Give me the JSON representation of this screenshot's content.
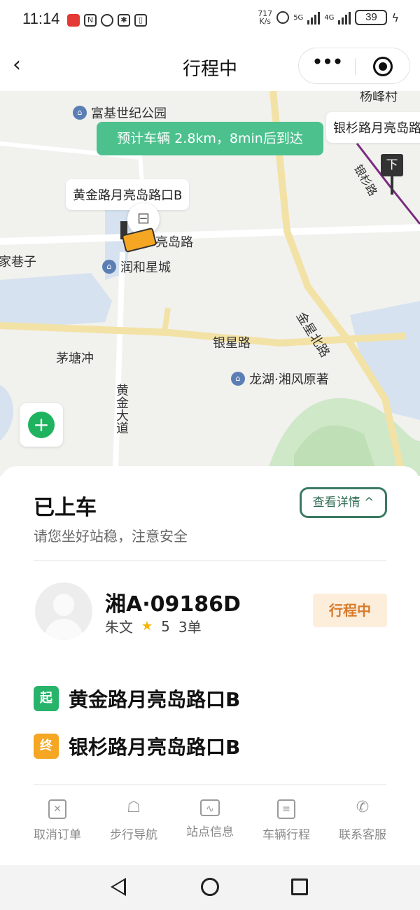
{
  "status_bar": {
    "time": "11:14",
    "net_speed_value": "717",
    "net_speed_unit": "K/s",
    "battery": "39",
    "signal_5g": "5G",
    "signal_4g": "4G"
  },
  "nav": {
    "title": "行程中",
    "back_icon": "chevron-left-icon",
    "more_icon": "more-dots-icon",
    "target_icon": "target-icon"
  },
  "map": {
    "eta_text": "预计车辆 2.8km，8min后到达",
    "pickup_stop": "黄金路月亮岛路口B",
    "dropoff_stop": "银杉路月亮岛路",
    "dropoff_marker": "下",
    "roads": {
      "moon_island_road": "亮岛路",
      "yinxing_road": "银星路",
      "jinxing_north_road": "金星北路",
      "huangjin_avenue": "黄金大道",
      "yinshan_road": "银杉路"
    },
    "places": {
      "fuji_park": "富基世纪公园",
      "runhe_city": "润和星城",
      "longhu": "龙湖·湘风原著",
      "maotangchong": "茅塘冲",
      "jia_alley": "家巷子",
      "yangfeng_village": "杨峰村"
    }
  },
  "sheet": {
    "title": "已上车",
    "subtitle": "请您坐好站稳，注意安全",
    "details_label": "查看详情 ^",
    "plate": "湘A·09186D",
    "driver_name": "朱文",
    "rating": "5",
    "orders": "3单",
    "status_badge": "行程中",
    "start_tag": "起",
    "start_stop": "黄金路月亮岛路口B",
    "end_tag": "终",
    "end_stop": "银杉路月亮岛路口B"
  },
  "actions": [
    {
      "label": "取消订单",
      "icon": "cancel-order-icon"
    },
    {
      "label": "步行导航",
      "icon": "walking-icon"
    },
    {
      "label": "站点信息",
      "icon": "station-info-icon"
    },
    {
      "label": "车辆行程",
      "icon": "vehicle-trip-icon"
    },
    {
      "label": "联系客服",
      "icon": "phone-icon"
    }
  ],
  "colors": {
    "accent_green": "#4cc18e",
    "start_green": "#27b36a",
    "end_orange": "#f5a623",
    "status_orange": "#d87a2a",
    "details_border": "#3c7a62"
  }
}
